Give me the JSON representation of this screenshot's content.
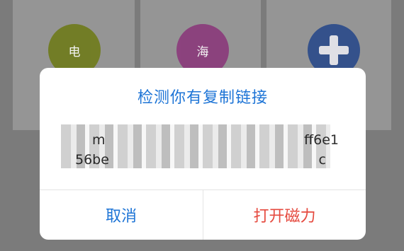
{
  "background_apps": [
    {
      "name": "电",
      "color": "#6f7b1a"
    },
    {
      "name": "海",
      "color": "#8b3a7b"
    },
    {
      "name": "add",
      "icon": "plus-icon",
      "color": "#2a4a8b"
    }
  ],
  "dialog": {
    "title": "检测你有复制链接",
    "message_line1_head": "m",
    "message_line1_tail": "ff6e1",
    "message_line2_head": "56be",
    "message_line2_tail": "c",
    "cancel_label": "取消",
    "confirm_label": "打开磁力",
    "title_color": "#1d74d6",
    "confirm_color": "#e54a3f"
  }
}
